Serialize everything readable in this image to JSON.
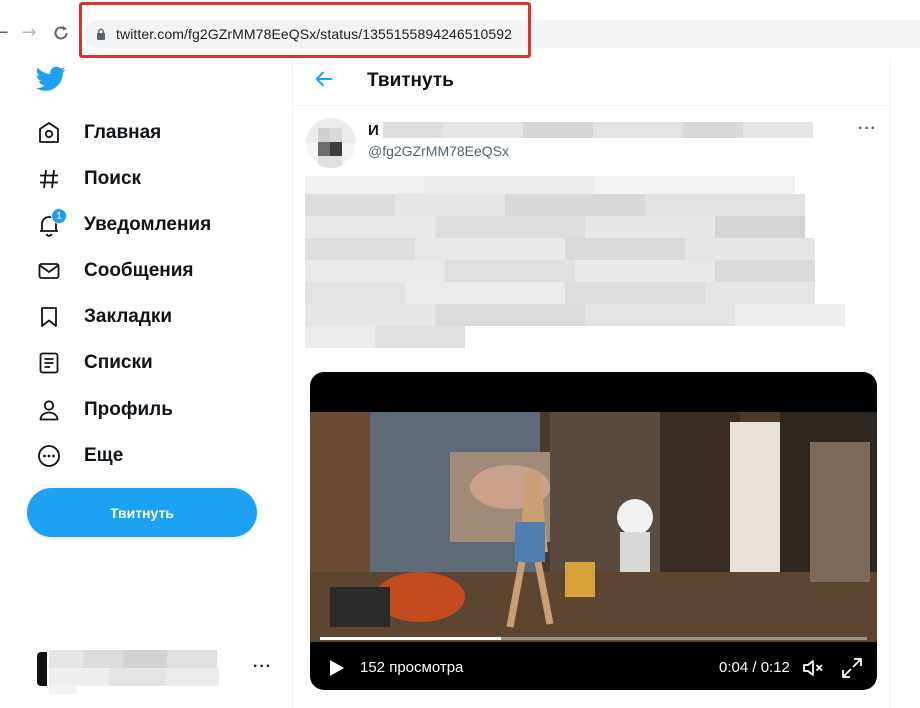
{
  "browser": {
    "url": "twitter.com/fg2GZrMM78EeQSx/status/1355155894246510592",
    "icons": [
      "back-arrow-icon",
      "forward-arrow-icon",
      "reload-icon",
      "lock-icon"
    ],
    "highlight_color": "#e0322b"
  },
  "sidebar": {
    "logo": "twitter-bird-icon",
    "items": [
      {
        "label": "Главная",
        "icon": "home-icon"
      },
      {
        "label": "Поиск",
        "icon": "hashtag-icon"
      },
      {
        "label": "Уведомления",
        "icon": "bell-icon",
        "badge": "1"
      },
      {
        "label": "Сообщения",
        "icon": "envelope-icon"
      },
      {
        "label": "Закладки",
        "icon": "bookmark-icon"
      },
      {
        "label": "Списки",
        "icon": "list-icon"
      },
      {
        "label": "Профиль",
        "icon": "person-icon"
      },
      {
        "label": "Еще",
        "icon": "more-circle-icon"
      }
    ],
    "tweet_button": "Твитнуть",
    "account_more": "···"
  },
  "main": {
    "header_title": "Твитнуть",
    "tweet": {
      "author_name_initial": "И",
      "handle": "@fg2GZrMM78EeQSx",
      "more": "···",
      "video": {
        "views": "152 просмотра",
        "time": "0:04 / 0:12",
        "progress": 0.33
      }
    }
  },
  "colors": {
    "accent": "#1da1f2",
    "text": "#0f1419",
    "secondary_text": "#536471"
  }
}
